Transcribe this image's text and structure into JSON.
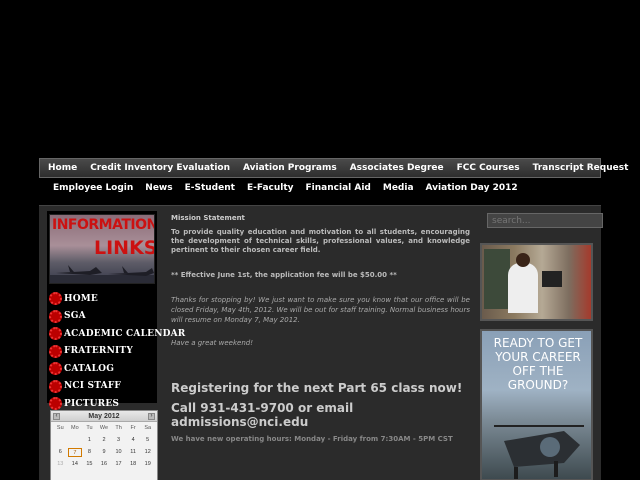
{
  "topnav": [
    "Home",
    "Credit Inventory Evaluation",
    "Aviation Programs",
    "Associates Degree",
    "FCC Courses",
    "Transcript Request"
  ],
  "subnav": [
    "Employee Login",
    "News",
    "E-Student",
    "E-Faculty",
    "Financial Aid",
    "Media",
    "Aviation Day 2012"
  ],
  "banner": {
    "line1": "INFORMATION",
    "line2": "LINKS"
  },
  "links": [
    "HOME",
    "SGA",
    "ACADEMIC CALENDAR",
    "FRATERNITY",
    "CATALOG",
    "NCI STAFF",
    "PICTURES"
  ],
  "calendar": {
    "title": "May 2012",
    "dow": [
      "Su",
      "Mo",
      "Tu",
      "We",
      "Th",
      "Fr",
      "Sa"
    ],
    "rows": [
      [
        "",
        "",
        "1",
        "2",
        "3",
        "4",
        "5"
      ],
      [
        "6",
        "7",
        "8",
        "9",
        "10",
        "11",
        "12"
      ],
      [
        "13",
        "14",
        "15",
        "16",
        "17",
        "18",
        "19"
      ]
    ],
    "today": "7"
  },
  "content": {
    "mission_title": "Mission Statement",
    "mission_text": "To provide quality education and motivation to all students, encouraging the development of technical skills, professional values, and knowledge pertinent to their chosen career field.",
    "fee": "** Effective June 1st, the application fee will be $50.00 **",
    "notice": "Thanks for stopping by!  We just want to make sure you know that our office will be closed Friday, May 4th, 2012.  We will be out for staff training.  Normal business hours will resume on Monday 7, May 2012.",
    "weekend": "Have a great weekend!",
    "register": "Registering for the next Part 65 class now!",
    "call": "Call 931-431-9700 or email admissions@nci.edu",
    "hours": "We have  new operating hours:  Monday - Friday from 7:30AM - 5PM CST"
  },
  "search": {
    "placeholder": "search..."
  },
  "ad": {
    "text": "READY TO GET YOUR CAREER OFF THE GROUND?"
  }
}
